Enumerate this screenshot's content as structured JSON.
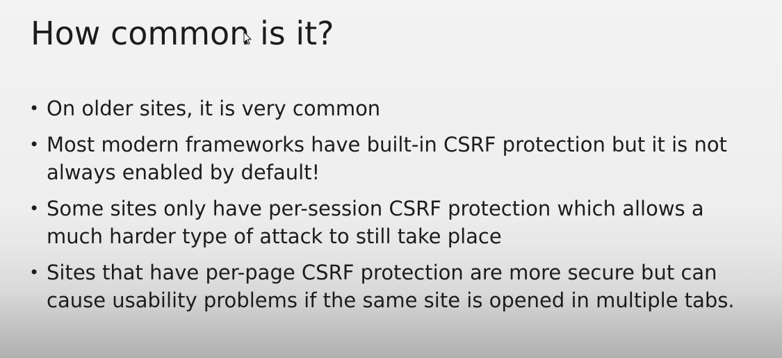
{
  "slide": {
    "title": "How common is it?",
    "bullet_symbol": "•",
    "bullets": [
      {
        "lines": [
          "On older sites, it is very common"
        ]
      },
      {
        "lines": [
          "Most modern frameworks have built-in CSRF protection but it is not",
          "always enabled by default!"
        ]
      },
      {
        "lines": [
          "Some sites only have per-session CSRF protection which allows a",
          "much harder type of attack to still take place"
        ]
      },
      {
        "lines": [
          "Sites that have per-page CSRF protection are more secure but can",
          "cause usability problems if the same site is opened in multiple tabs."
        ]
      }
    ]
  },
  "cursor": {
    "icon": "mouse-pointer-icon"
  },
  "colors": {
    "text": "#1c1c1c",
    "background_top": "#f3f3f3",
    "background_bottom": "#b0b0b0"
  }
}
